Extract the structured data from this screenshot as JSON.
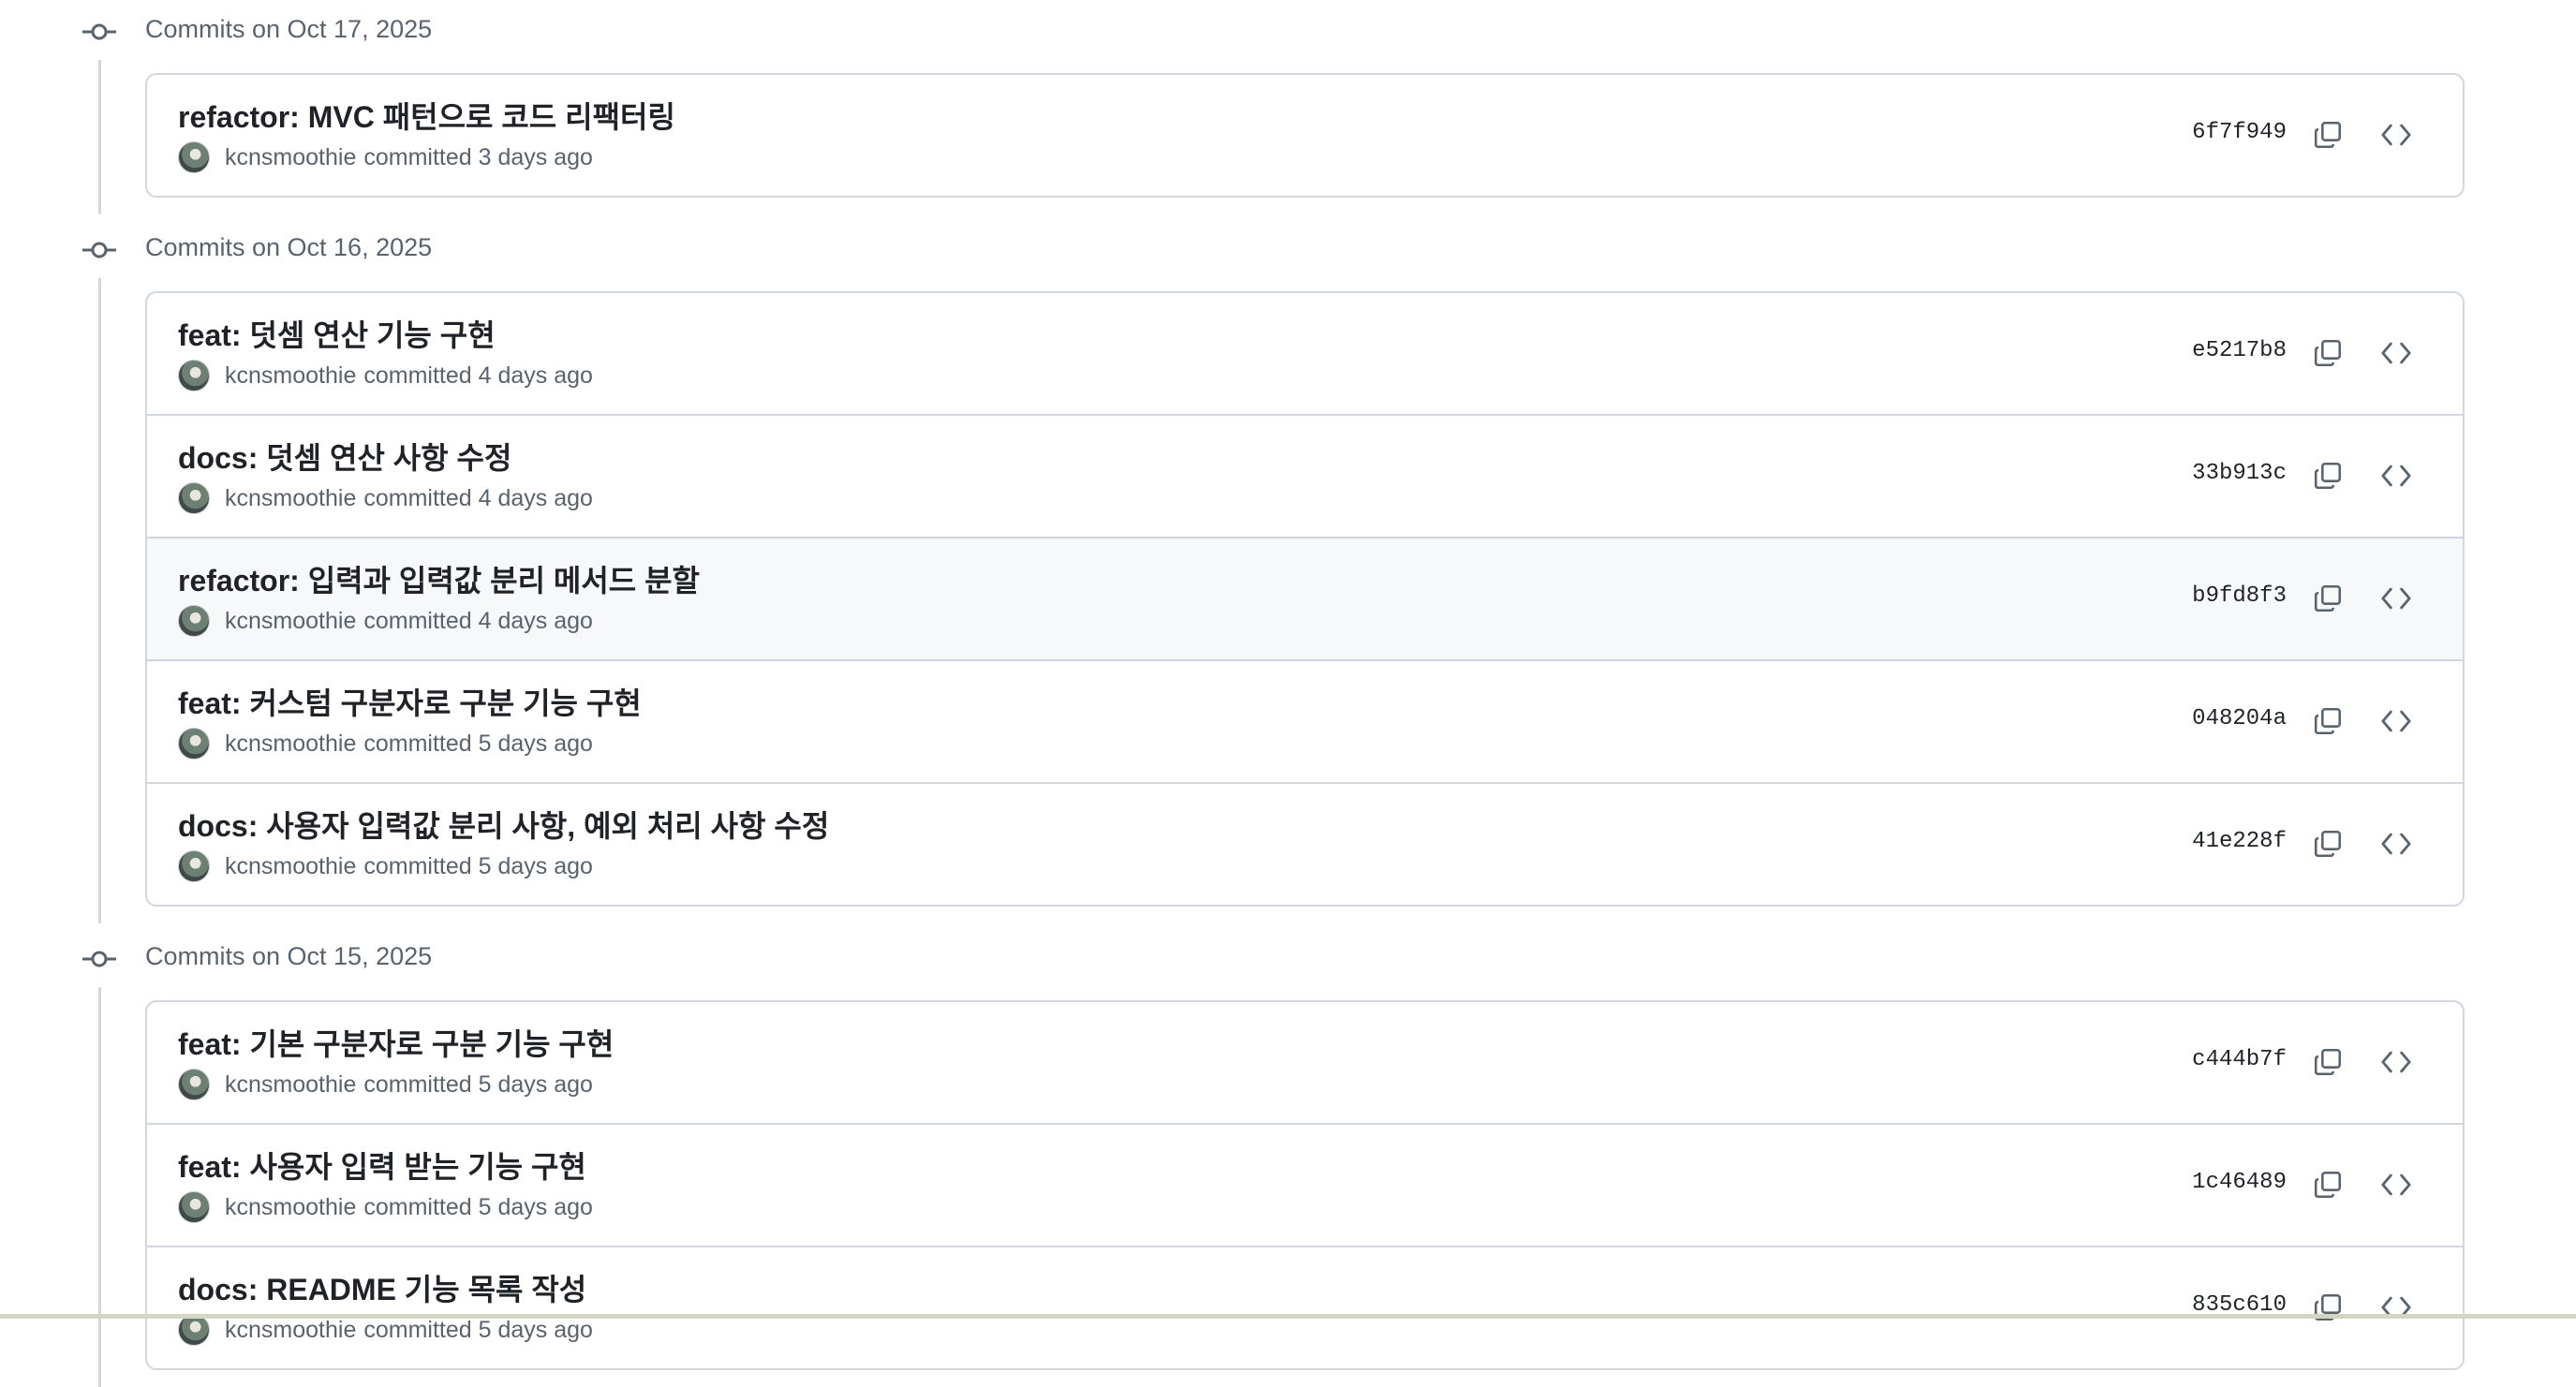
{
  "groups": [
    {
      "header": "Commits on Oct 17, 2025",
      "commits": [
        {
          "title": "refactor: MVC 패턴으로 코드 리팩터링",
          "author": "kcnsmoothie",
          "when": "committed 3 days ago",
          "sha": "6f7f949"
        }
      ]
    },
    {
      "header": "Commits on Oct 16, 2025",
      "commits": [
        {
          "title": "feat: 덧셈 연산 기능 구현",
          "author": "kcnsmoothie",
          "when": "committed 4 days ago",
          "sha": "e5217b8"
        },
        {
          "title": "docs: 덧셈 연산 사항 수정",
          "author": "kcnsmoothie",
          "when": "committed 4 days ago",
          "sha": "33b913c"
        },
        {
          "title": "refactor: 입력과 입력값 분리 메서드 분할",
          "author": "kcnsmoothie",
          "when": "committed 4 days ago",
          "sha": "b9fd8f3",
          "hovered": true
        },
        {
          "title": "feat: 커스텀 구분자로 구분 기능 구현",
          "author": "kcnsmoothie",
          "when": "committed 5 days ago",
          "sha": "048204a"
        },
        {
          "title": "docs: 사용자 입력값 분리 사항, 예외 처리 사항 수정",
          "author": "kcnsmoothie",
          "when": "committed 5 days ago",
          "sha": "41e228f"
        }
      ]
    },
    {
      "header": "Commits on Oct 15, 2025",
      "commits": [
        {
          "title": "feat: 기본 구분자로 구분 기능 구현",
          "author": "kcnsmoothie",
          "when": "committed 5 days ago",
          "sha": "c444b7f"
        },
        {
          "title": "feat: 사용자 입력 받는 기능 구현",
          "author": "kcnsmoothie",
          "when": "committed 5 days ago",
          "sha": "1c46489"
        },
        {
          "title": "docs: README 기능 목록 작성",
          "author": "kcnsmoothie",
          "when": "committed 5 days ago",
          "sha": "835c610"
        }
      ]
    }
  ],
  "icons": {
    "group": "git-commit-icon",
    "copy": "copy-icon",
    "browse": "code-brackets-icon"
  },
  "colors": {
    "border": "#d0d7de",
    "muted": "#59636e",
    "text": "#1f2328",
    "hover_bg": "#f6f8fa"
  }
}
